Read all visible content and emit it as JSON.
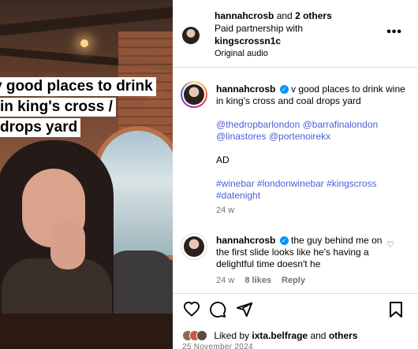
{
  "overlay_text": [
    "v good places to drink",
    "in king's cross /",
    "drops yard"
  ],
  "header": {
    "author": "hannahcrosb",
    "and_text": "and",
    "others": "2 others",
    "partnership": "Paid partnership with",
    "partner": "kingscrossn1c",
    "audio": "Original audio",
    "more_icon": "more-horizontal-icon"
  },
  "caption": {
    "author": "hannahcrosb",
    "text": "v good places to drink wine in king's cross and coal drops yard",
    "mentions": "@thedropbarlondon @barrafinalondon @linastores @portenoirekx",
    "ad": "AD",
    "hashtags": "#winebar #londonwinebar #kingscross #datenight",
    "time": "24 w"
  },
  "comment": {
    "author": "hannahcrosb",
    "text": "the guy behind me on the first slide looks like he's having a delightful time doesn't he",
    "time": "24 w",
    "likes": "8 likes",
    "reply": "Reply"
  },
  "actions": {
    "liked_by_prefix": "Liked by",
    "liked_by_user": "ixta.belfrage",
    "liked_by_and": "and",
    "liked_by_others": "others",
    "date": "25 November 2024"
  },
  "colors": {
    "link": "#4c5fd5",
    "verified": "#0095f6",
    "meta": "#737373"
  }
}
